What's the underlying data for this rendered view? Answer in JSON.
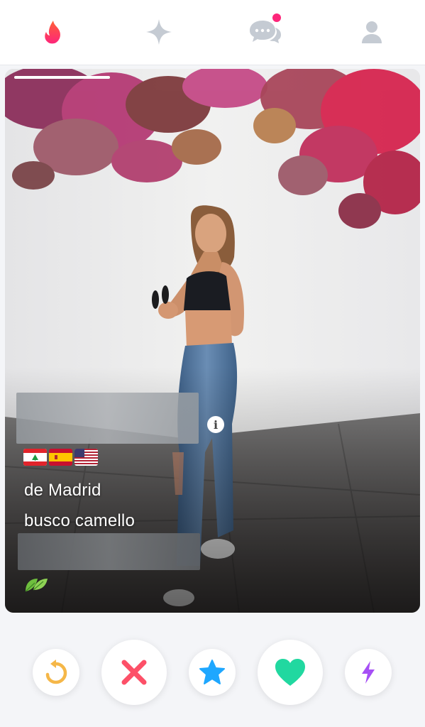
{
  "nav": {
    "tabs": [
      {
        "name": "discover",
        "icon": "flame-icon",
        "active": true
      },
      {
        "name": "explore",
        "icon": "sparkle-icon",
        "active": false
      },
      {
        "name": "messages",
        "icon": "chat-bubbles-icon",
        "has_notification": true
      },
      {
        "name": "profile",
        "icon": "person-icon",
        "active": false
      }
    ]
  },
  "card": {
    "photo_index": 1,
    "photo_count": 4,
    "name_age": "",
    "flags": [
      "Lebanon flag",
      "Spain flag",
      "United States flag"
    ],
    "bio_lines": [
      "de Madrid",
      "busco camello"
    ],
    "bio_emoji": "leaf-icon",
    "info_icon": "i"
  },
  "actions": [
    {
      "name": "rewind",
      "icon": "rewind-icon",
      "color": "#f5b748"
    },
    {
      "name": "nope",
      "icon": "x-icon",
      "color": "#fd5068"
    },
    {
      "name": "super-like",
      "icon": "star-icon",
      "color": "#1ec3ff"
    },
    {
      "name": "like",
      "icon": "heart-icon",
      "color": "#21d8a0"
    },
    {
      "name": "boost",
      "icon": "bolt-icon",
      "color": "#a64ff5"
    }
  ],
  "colors": {
    "brand": "#fd5564",
    "inactive_icon": "#c5cbd3",
    "notification": "#fd267a"
  }
}
